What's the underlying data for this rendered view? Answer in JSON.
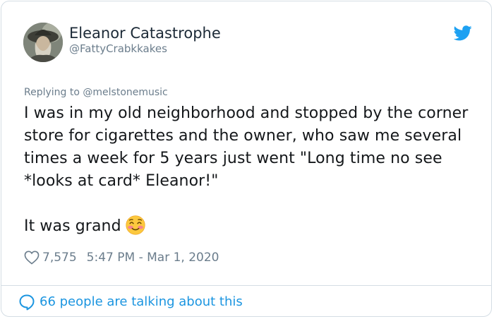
{
  "tweet": {
    "author_name": "Eleanor Catastrophe",
    "author_handle": "@FattyCrabkkakes",
    "replying_prefix": "Replying to",
    "replying_to": "@melstonemusic",
    "paragraph_1": "I was in my old neighborhood and stopped by the corner store for cigarettes and the owner, who saw me several times a week for 5 years just went \"Long time no see *looks at card* Eleanor!\"",
    "paragraph_2": "It was grand",
    "emoji": "smiling-face-with-blush-icon",
    "likes": "7,575",
    "timestamp": "5:47 PM - Mar 1, 2020",
    "talking": "66 people are talking about this"
  },
  "colors": {
    "accent": "#1b95e0",
    "muted": "#6b7d8c",
    "text": "#14171a",
    "border": "#d4dde4"
  }
}
